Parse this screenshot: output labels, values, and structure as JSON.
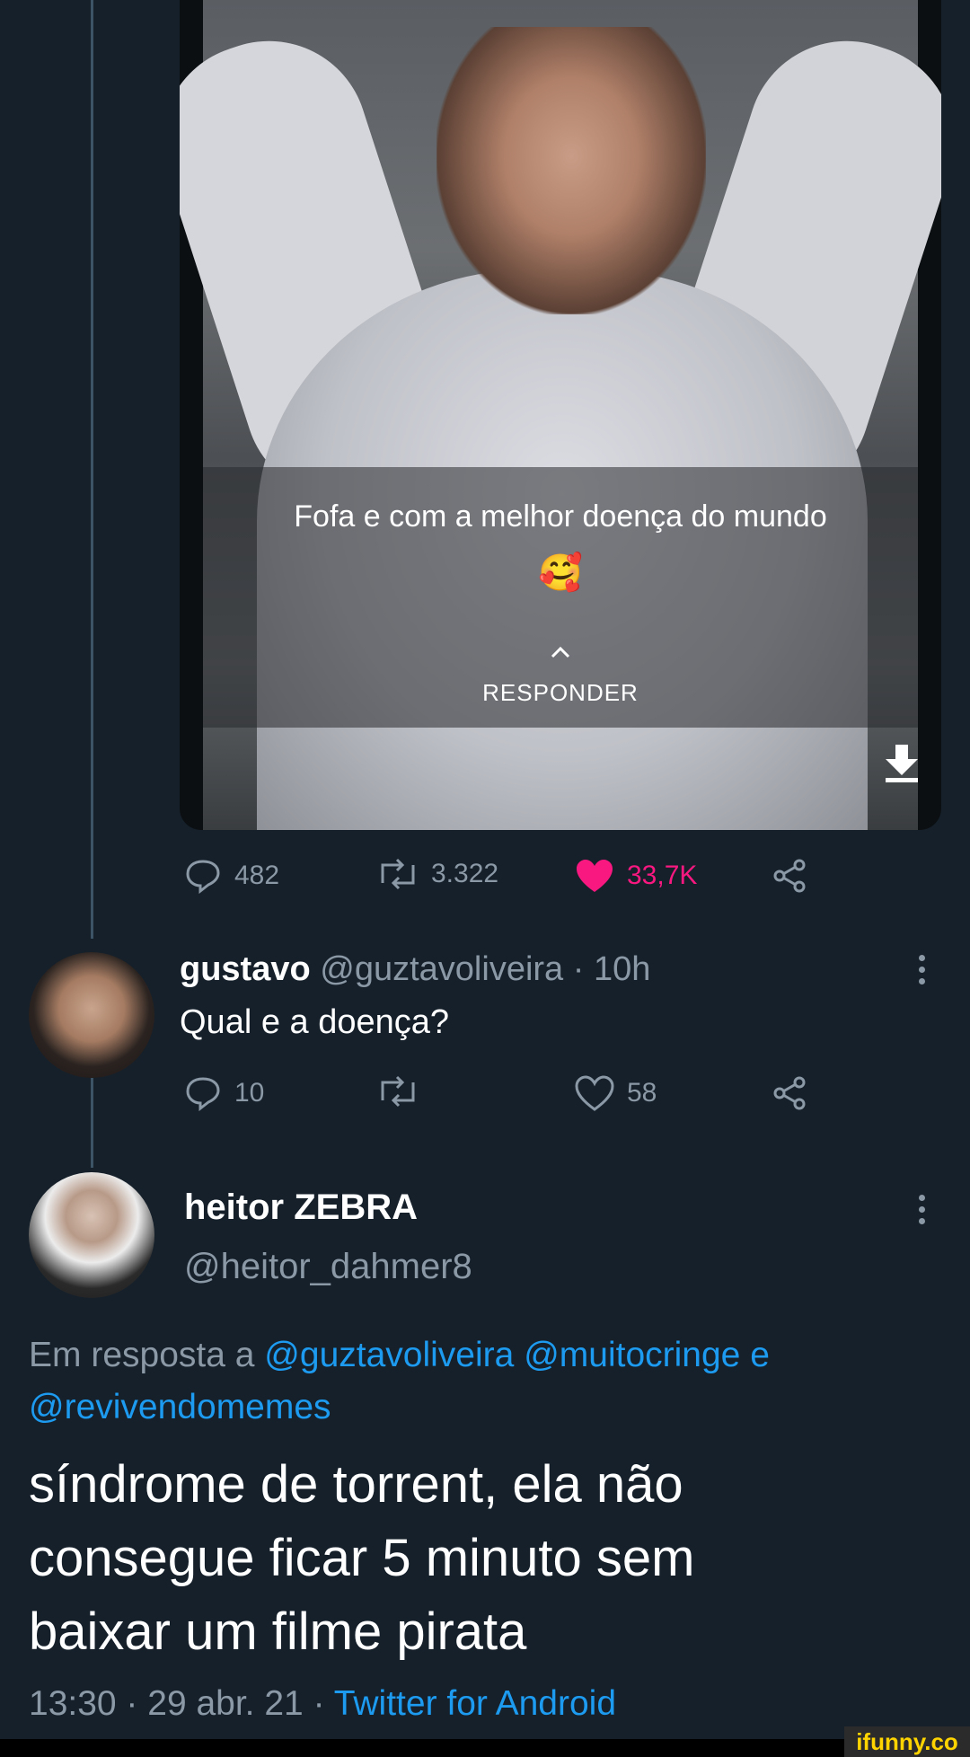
{
  "media": {
    "overlay_caption": "Fofa e com a melhor doença do mundo",
    "overlay_emoji": "🥰",
    "overlay_reply_label": "RESPONDER",
    "icons": {
      "download": "download-icon",
      "reply_chevron": "chevron-up-icon"
    }
  },
  "main_tweet_actions": {
    "replies": "482",
    "retweets": "3.322",
    "likes": "33,7K",
    "liked": true,
    "like_color": "#f91880"
  },
  "reply_1": {
    "display_name": "gustavo",
    "handle": "@guztavoliveira",
    "separator": "·",
    "time": "10h",
    "text": "Qual e a doença?",
    "actions": {
      "replies": "10",
      "retweets": "",
      "likes": "58"
    }
  },
  "reply_2": {
    "display_name": "heitor ZEBRA",
    "handle": "@heitor_dahmer8",
    "in_reply_prefix": "Em resposta a",
    "mention_1": "@guztavoliveira",
    "mention_2": "@muitocringe",
    "conjunction": "e",
    "mention_3": "@revivendomemes",
    "text_line_1": "síndrome de torrent, ela não",
    "text_line_2": "consegue ficar 5 minuto sem",
    "text_line_3": "baixar um filme pirata",
    "timestamp": "13:30 · 29 abr. 21 ·",
    "client": "Twitter for Android"
  },
  "watermark": "ifunny.co",
  "colors": {
    "background": "#15202b",
    "muted": "#8b98a5",
    "link": "#1d9bf0",
    "like": "#f91880"
  }
}
